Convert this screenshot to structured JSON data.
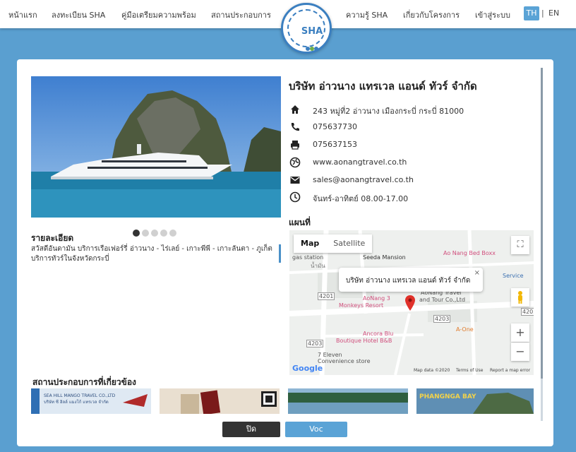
{
  "nav": {
    "items": [
      "หน้าแรก",
      "ลงทะเบียน SHA",
      "คู่มือเตรียมความพร้อม",
      "สถานประกอบการ",
      "ความรู้ SHA",
      "เกี่ยวกับโครงการ",
      "เข้าสู่ระบบ"
    ],
    "lang_th": "TH",
    "lang_sep": "|",
    "lang_en": "EN",
    "logo_text": "SHA"
  },
  "company": {
    "name": "บริษัท อ่าวนาง แทรเวล แอนด์ ทัวร์ จำกัด",
    "address": "243 หมู่ที่2 อ่าวนาง เมืองกระบี่ กระบี่ 81000",
    "phone": "075637730",
    "fax": "075637153",
    "website": "www.aonangtravel.co.th",
    "email": "sales@aonangtravel.co.th",
    "hours": "จันทร์-อาทิตย์ 08.00-17.00"
  },
  "details": {
    "title": "รายละเอียด",
    "text": "สวัสดีอันดามัน บริการเรือเฟอร์รี่ อ่าวนาง - ไร่เลย์ - เกาะพีพี - เกาะลันตา - ภูเก็ต บริการทัวร์ในจังหวัดกระบี่"
  },
  "map": {
    "title": "แผนที่",
    "btn_map": "Map",
    "btn_satellite": "Satellite",
    "popup": "บริษัท อ่าวนาง แทรเวล แอนด์ ทัวร์ จำกัด",
    "popup_close": "×",
    "zoom_in": "+",
    "zoom_out": "−",
    "fullscreen": "⛶",
    "labels": {
      "gas_station": "gas station",
      "gas_station_th": "น้ำมัน",
      "seeda": "Seeda Mansion",
      "bed_boxx": "Ao Nang Bed Boxx",
      "service": "Service",
      "aonang3": "AoNang 3",
      "monkeys": "Monkeys Resort",
      "travel": "AoNang Travel",
      "tour": "and Tour Co.,Ltd",
      "ancora": "Ancora Blu",
      "boutique": "Boutique Hotel B&B",
      "aone": "A-One",
      "eleven": "7 Eleven",
      "convenience": "Convenience store",
      "r4201a": "4201",
      "r4203a": "4203",
      "r4203b": "4203",
      "r4203c": "4203",
      "google": "Google",
      "map_data": "Map data ©2020",
      "terms": "Terms of Use",
      "report": "Report a map error"
    }
  },
  "related": {
    "title": "สถานประกอบการที่เกี่ยวข้อง",
    "thumb1_line1": "SEA HILL MANGO TRAVEL CO.,LTD",
    "thumb1_line2": "บริษัท ซี ฮิลล์ แมงโก้ แทรเวล จำกัด",
    "thumb4_text": "PHANGNGA BAY"
  },
  "buttons": {
    "close": "ปิด",
    "ok": "Voc"
  },
  "colors": {
    "background": "#5a9fd0",
    "accent": "#5aa3d6",
    "close_btn": "#333333"
  }
}
